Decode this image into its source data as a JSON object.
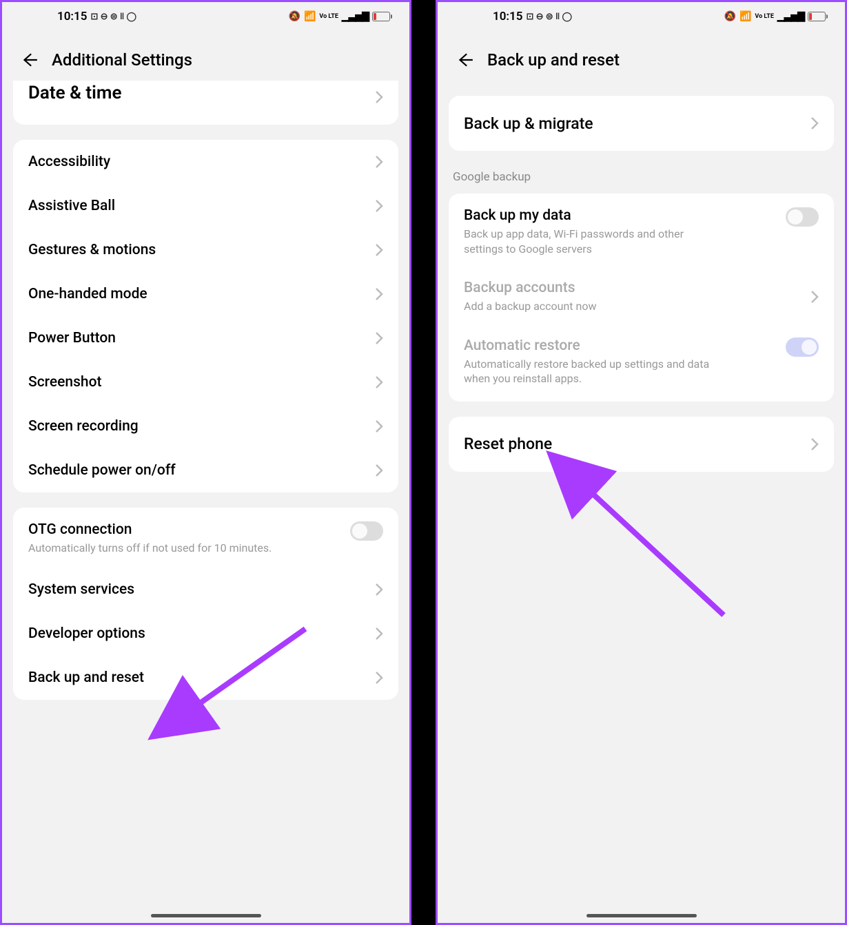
{
  "status": {
    "time": "10:15",
    "icons_left": "⊡ ⊖ ⊜ ‖ ◯",
    "icons_right_silent": "🔕",
    "icons_right_wifi": "📶",
    "icons_right_vo": "Vo LTE",
    "icons_right_signal": "▁▃▅▇"
  },
  "left_screen": {
    "title": "Additional Settings",
    "cut_row": "Date & time",
    "group1": [
      "Accessibility",
      "Assistive Ball",
      "Gestures & motions",
      "One-handed mode",
      "Power Button",
      "Screenshot",
      "Screen recording",
      "Schedule power on/off"
    ],
    "otg": {
      "title": "OTG connection",
      "sub": "Automatically turns off if not used for 10 minutes."
    },
    "group2": [
      "System services",
      "Developer options",
      "Back up and reset"
    ]
  },
  "right_screen": {
    "title": "Back up and reset",
    "backup_migrate": "Back up & migrate",
    "section": "Google backup",
    "backup_my_data": {
      "title": "Back up my data",
      "sub": "Back up app data, Wi-Fi passwords and other settings to Google servers"
    },
    "backup_accounts": {
      "title": "Backup accounts",
      "sub": "Add a backup account now"
    },
    "auto_restore": {
      "title": "Automatic restore",
      "sub": "Automatically restore backed up settings and data when you reinstall apps."
    },
    "reset_phone": "Reset phone"
  }
}
